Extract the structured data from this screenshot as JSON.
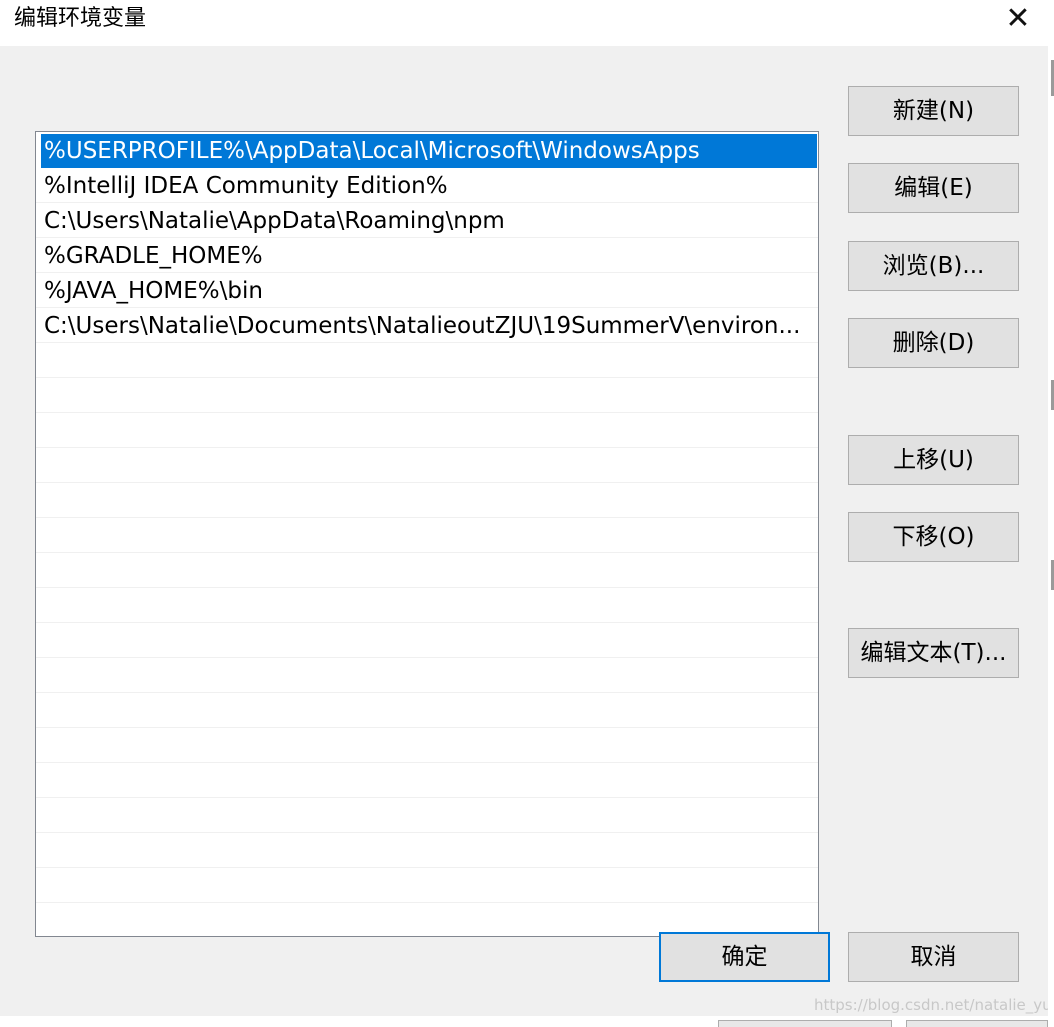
{
  "window": {
    "title": "编辑环境变量",
    "close_symbol": "✕"
  },
  "path_list": {
    "entries": [
      "%USERPROFILE%\\AppData\\Local\\Microsoft\\WindowsApps",
      "%IntelliJ IDEA Community Edition%",
      "C:\\Users\\Natalie\\AppData\\Roaming\\npm",
      "%GRADLE_HOME%",
      "%JAVA_HOME%\\bin",
      "C:\\Users\\Natalie\\Documents\\NatalieoutZJU\\19SummerV\\environ..."
    ],
    "selected_index": 0
  },
  "buttons": {
    "new": "新建(N)",
    "edit": "编辑(E)",
    "browse": "浏览(B)...",
    "delete": "删除(D)",
    "move_up": "上移(U)",
    "move_down": "下移(O)",
    "edit_text": "编辑文本(T)...",
    "ok": "确定",
    "cancel": "取消"
  },
  "watermark": "https://blog.csdn.net/natalie_yu",
  "colors": {
    "selection": "#0078d7",
    "button_face": "#e1e1e1",
    "dialog_bg": "#f0f0f0"
  }
}
